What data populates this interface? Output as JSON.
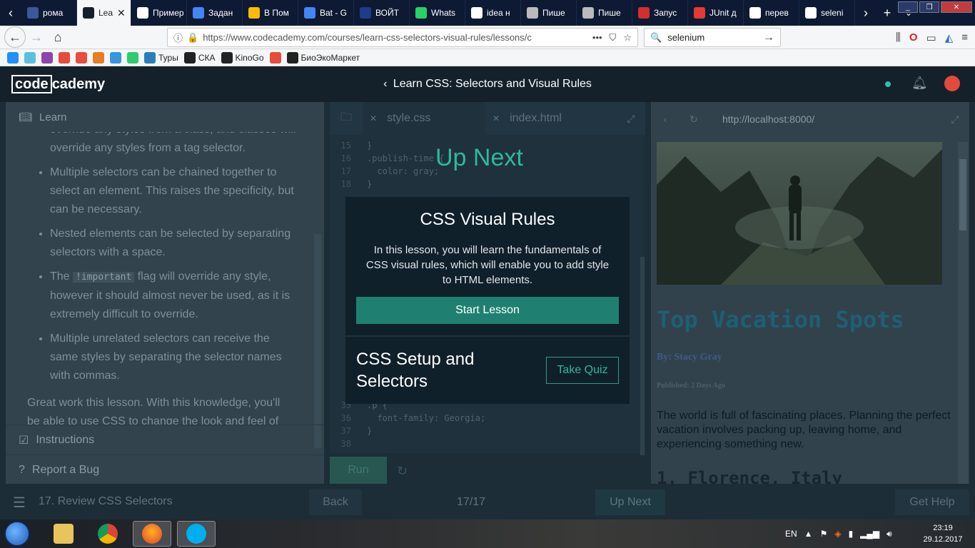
{
  "browser": {
    "tabs": [
      {
        "label": "рома",
        "color": "#3b5998"
      },
      {
        "label": "Lea",
        "color": "#14212b",
        "active": true
      },
      {
        "label": "Пример м",
        "color": "#ffffff"
      },
      {
        "label": "Задан",
        "color": "#4285f4"
      },
      {
        "label": "В Пом",
        "color": "#fbbc05"
      },
      {
        "label": "Bat - G",
        "color": "#4285f4"
      },
      {
        "label": "ВОЙТ",
        "color": "#1c3c8c"
      },
      {
        "label": "Whats",
        "color": "#25d366"
      },
      {
        "label": "idea н",
        "color": "#ffffff"
      },
      {
        "label": "Пише",
        "color": "#bbbbbb"
      },
      {
        "label": "Пише",
        "color": "#bbbbbb"
      },
      {
        "label": "Запус",
        "color": "#d32f2f"
      },
      {
        "label": "JUnit д",
        "color": "#e53935"
      },
      {
        "label": "перев",
        "color": "#ffffff"
      },
      {
        "label": "seleni",
        "color": "#ffffff"
      }
    ],
    "new_tab_label": "+",
    "url": "https://www.codecademy.com/courses/learn-css-selectors-visual-rules/lessons/c",
    "url_more": "•••",
    "search_value": "selenium",
    "bookmarks": [
      {
        "label": "",
        "color": "#1e90ff"
      },
      {
        "label": "",
        "color": "#5bc0de"
      },
      {
        "label": "",
        "color": "#8e44ad"
      },
      {
        "label": "",
        "color": "#e74c3c"
      },
      {
        "label": "",
        "color": "#e74c3c"
      },
      {
        "label": "",
        "color": "#e67e22"
      },
      {
        "label": "",
        "color": "#3498db"
      },
      {
        "label": "",
        "color": "#2ecc71"
      },
      {
        "label": "Туры",
        "color": "#2980b9"
      },
      {
        "label": "СКА",
        "color": "#222222"
      },
      {
        "label": "KinoGo",
        "color": "#222222"
      },
      {
        "label": "",
        "color": "#e74c3c"
      },
      {
        "label": "БиоЭкоМаркет",
        "color": "#222222"
      }
    ]
  },
  "header": {
    "logo_left": "code",
    "logo_right": "cademy",
    "course_title": "Learn CSS: Selectors and Visual Rules",
    "back_glyph": "‹"
  },
  "learn": {
    "tab_label": "Learn",
    "fragment": "override any styles from a class, and classes will override any styles from a tag selector.",
    "bullets": [
      "Multiple selectors can be chained together to select an element. This raises the specificity, but can be necessary.",
      "Nested elements can be selected by separating selectors with a space."
    ],
    "important_pre": "The",
    "important_code": "!important",
    "important_post": "flag will override any style, however it should almost never be used, as it is extremely difficult to override.",
    "last_bullet": "Multiple unrelated selectors can receive the same styles by separating the selector names with commas.",
    "closing": "Great work this lesson. With this knowledge, you'll be able to use CSS to change the look and feel of",
    "instructions_label": "Instructions",
    "bug_label": "Report a Bug"
  },
  "editor": {
    "tabs": [
      "style.css",
      "index.html"
    ],
    "lines_top": [
      {
        "n": "15",
        "code": "}"
      },
      {
        "n": "16",
        "code": ".publish-time {"
      },
      {
        "n": "17",
        "code": "  color: gray;"
      },
      {
        "n": "18",
        "code": "}"
      }
    ],
    "lines_bottom": [
      {
        "n": "35",
        "code": ".p {"
      },
      {
        "n": "36",
        "code": "  font-family: Georgia;"
      },
      {
        "n": "37",
        "code": "}"
      },
      {
        "n": "38",
        "code": ""
      }
    ],
    "run_label": "Run"
  },
  "upnext": {
    "heading": "Up Next",
    "lesson_title": "CSS Visual Rules",
    "lesson_desc": "In this lesson, you will learn the fundamentals of CSS visual rules, which will enable you to add style to HTML elements.",
    "start_label": "Start Lesson",
    "quiz_title": "CSS Setup and Selectors",
    "quiz_label": "Take Quiz"
  },
  "preview": {
    "url": "http://localhost:8000/",
    "title": "Top Vacation Spots",
    "byline": "By: Stacy Gray",
    "published": "Published: 2 Days Ago",
    "intro": "The world is full of fascinating places. Planning the perfect vacation involves packing up, leaving home, and experiencing something new.",
    "section": "1. Florence, Italy"
  },
  "footer": {
    "lesson": "17. Review CSS Selectors",
    "back_label": "Back",
    "progress": "17/17",
    "upnext_label": "Up Next",
    "help_label": "Get Help"
  },
  "taskbar": {
    "lang": "EN",
    "time": "23:19",
    "date": "29.12.2017"
  }
}
